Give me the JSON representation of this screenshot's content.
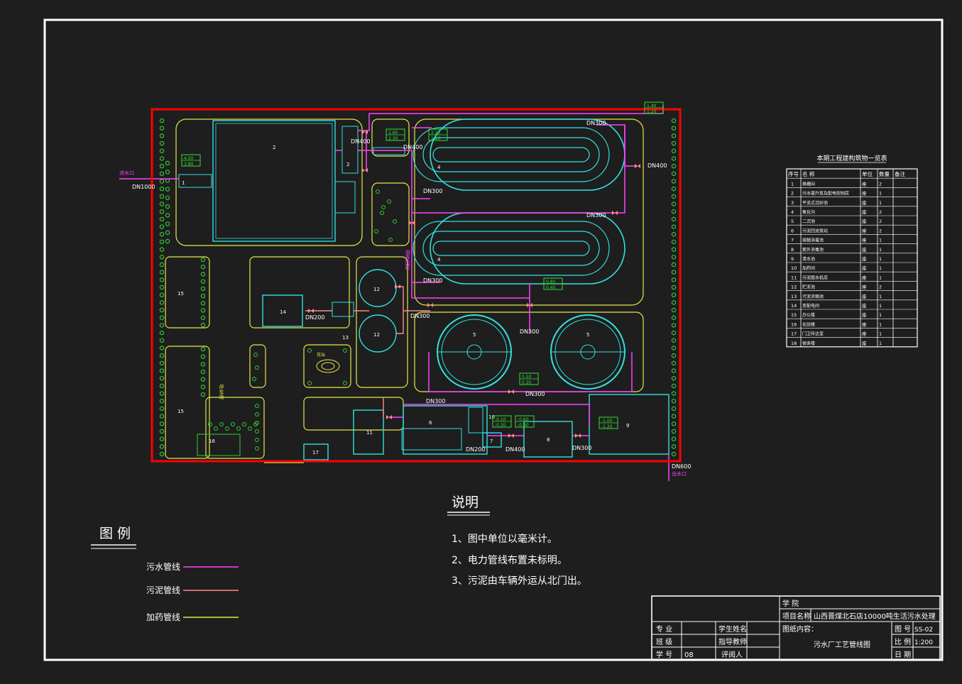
{
  "colors": {
    "background": "#1e1e1e",
    "frame": "#ffffff",
    "site_boundary": "#ff0000",
    "road": "#e6e64a",
    "structure": "#33e0e0",
    "sewage_pipe": "#ff40ff",
    "sludge_pipe": "#ff8a8a",
    "dosing_pipe": "#e6e64a",
    "tree": "#33cc33",
    "label_box": "#33dd33",
    "text": "#ffffff"
  },
  "site": {
    "inlet_label": "进水口",
    "inlet_pipe": "DN1000",
    "outlet_pipe": "DN600",
    "outlet_label": "出水口",
    "pipe_labels": [
      "DN400",
      "DN400",
      "DN300",
      "DN300",
      "DN300",
      "DN400",
      "DN200",
      "DN300",
      "DN300",
      "DN300",
      "DN300",
      "DN200",
      "DN400",
      "DN300"
    ],
    "unit_numbers": [
      "1",
      "2",
      "2",
      "4",
      "4",
      "5",
      "5",
      "6",
      "7",
      "8",
      "9",
      "10",
      "11",
      "12",
      "12",
      "13",
      "14",
      "15",
      "15",
      "16",
      "17"
    ],
    "elevation_tags": [
      {
        "top": "4.00",
        "bottom": "3.80"
      },
      {
        "top": "2.60",
        "bottom": "2.30"
      },
      {
        "top": "2.10",
        "bottom": "1.90"
      },
      {
        "top": "1.40",
        "bottom": "1.20"
      },
      {
        "top": "0.60",
        "bottom": "0.40"
      },
      {
        "top": "0.50",
        "bottom": "0.30"
      },
      {
        "top": "-0.10",
        "bottom": "-0.30"
      },
      {
        "top": "-0.60",
        "bottom": "-0.80"
      },
      {
        "top": "-1.00",
        "bottom": "-1.20"
      }
    ],
    "vertical_labels": [
      "消毒加药",
      "停车场",
      "花坛"
    ]
  },
  "structure_table": {
    "title": "本期工程建构筑物一览表",
    "headers": [
      "序号",
      "名 称",
      "单位",
      "数量",
      "备注"
    ],
    "rows": [
      [
        "1",
        "格栅间",
        "座",
        "2",
        ""
      ],
      [
        "2",
        "污水提升泵及配电控制房",
        "座",
        "1",
        ""
      ],
      [
        "3",
        "平流式沉砂池",
        "座",
        "1",
        ""
      ],
      [
        "4",
        "氧化沟",
        "座",
        "2",
        ""
      ],
      [
        "5",
        "二沉池",
        "座",
        "2",
        ""
      ],
      [
        "6",
        "污泥回流泵站",
        "座",
        "2",
        ""
      ],
      [
        "7",
        "接触消毒池",
        "座",
        "1",
        ""
      ],
      [
        "8",
        "紫外消毒池",
        "座",
        "1",
        ""
      ],
      [
        "9",
        "清水池",
        "座",
        "1",
        ""
      ],
      [
        "10",
        "加药间",
        "座",
        "1",
        ""
      ],
      [
        "11",
        "污泥脱水机房",
        "座",
        "1",
        ""
      ],
      [
        "12",
        "贮泥池",
        "座",
        "2",
        ""
      ],
      [
        "13",
        "污泥浓缩池",
        "座",
        "1",
        ""
      ],
      [
        "14",
        "变配电间",
        "座",
        "1",
        ""
      ],
      [
        "15",
        "办公楼",
        "座",
        "1",
        ""
      ],
      [
        "16",
        "化验楼",
        "座",
        "1",
        ""
      ],
      [
        "17",
        "门卫传达室",
        "座",
        "1",
        ""
      ],
      [
        "18",
        "宿舍楼",
        "座",
        "1",
        ""
      ]
    ]
  },
  "legend": {
    "title": "图  例",
    "items": [
      {
        "label": "污水管线",
        "color_key": "sewage_pipe"
      },
      {
        "label": "污泥管线",
        "color_key": "sludge_pipe"
      },
      {
        "label": "加药管线",
        "color_key": "dosing_pipe"
      }
    ]
  },
  "notes": {
    "title": "说明",
    "items": [
      "1、图中单位以毫米计。",
      "2、电力管线布置未标明。",
      "3、污泥由车辆外运从北门出。"
    ]
  },
  "title_block": {
    "school_label": "学    院",
    "school_value": "",
    "project_label": "项目名称",
    "project_value": "山西晋煤北石店10000吨生活污水处理",
    "drawing_content_label": "图纸内容：",
    "drawing_content_value": "污水厂工艺管线图",
    "drawing_no_label": "图 号",
    "drawing_no_value": "SS-02",
    "scale_label": "比 例",
    "scale_value": "1:200",
    "date_label": "日 期",
    "date_value": "",
    "major_label": "专    业",
    "major_value": "",
    "class_label": "班    级",
    "class_value": "",
    "student_no_label": "学    号",
    "student_no_value": "08",
    "student_name_label": "学生姓名",
    "student_name_value": "",
    "advisor_label": "指导教师",
    "advisor_value": "",
    "reviewer_label": "评阅人",
    "reviewer_value": ""
  }
}
